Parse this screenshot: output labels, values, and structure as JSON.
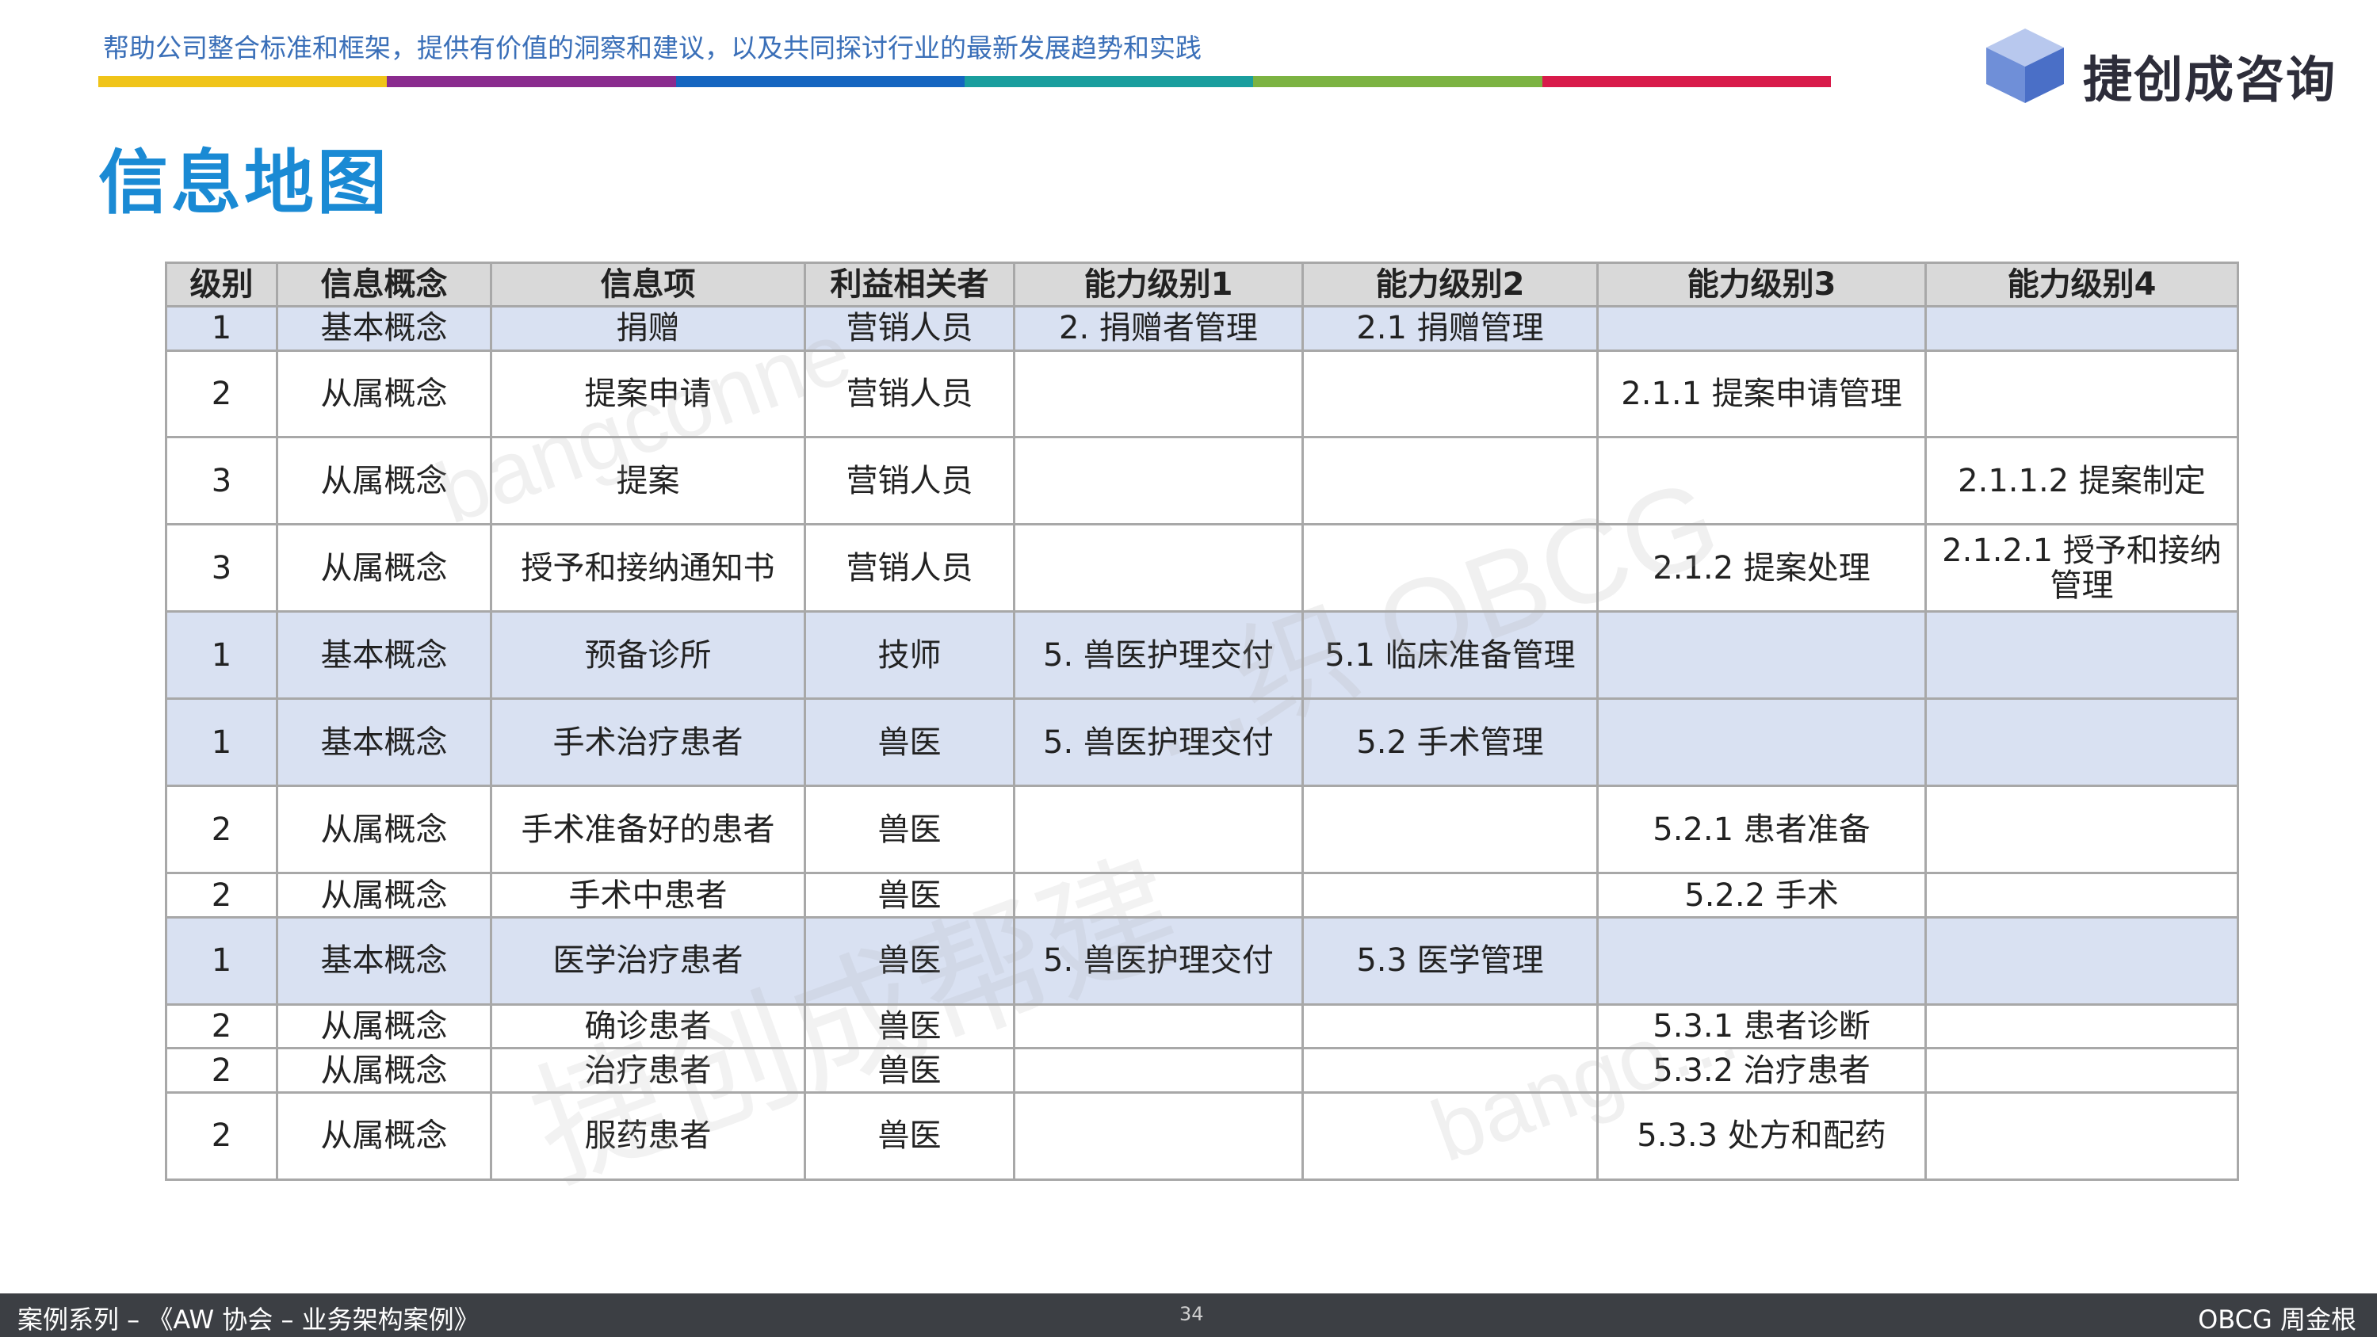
{
  "header": {
    "tagline": "帮助公司整合标准和框架，提供有价值的洞察和建议，以及共同探讨行业的最新发展趋势和实践",
    "bar_colors": [
      "#f0c419",
      "#8a2b8e",
      "#1565c0",
      "#1a9e9e",
      "#7cb342",
      "#d81b4a"
    ],
    "logo_text": "捷创成咨询",
    "logo_colors": [
      "#6f8fd8",
      "#4a6fc7",
      "#b8c8ee"
    ]
  },
  "title": "信息地图",
  "watermarks": [
    "bangconne",
    "...织 OBCG",
    "捷创成帮建",
    "bango..."
  ],
  "table": {
    "headers": [
      "级别",
      "信息概念",
      "信息项",
      "利益相关者",
      "能力级别1",
      "能力级别2",
      "能力级别3",
      "能力级别4"
    ],
    "rows": [
      {
        "level": "1",
        "concept": "基本概念",
        "item": "捐赠",
        "stakeholder": "营销人员",
        "cap1": "2. 捐赠者管理",
        "cap2": "2.1 捐赠管理",
        "cap3": "",
        "cap4": ""
      },
      {
        "level": "2",
        "concept": "从属概念",
        "item": "提案申请",
        "stakeholder": "营销人员",
        "cap1": "",
        "cap2": "",
        "cap3": "2.1.1 提案申请管理",
        "cap4": ""
      },
      {
        "level": "3",
        "concept": "从属概念",
        "item": "提案",
        "stakeholder": "营销人员",
        "cap1": "",
        "cap2": "",
        "cap3": "",
        "cap4": "2.1.1.2 提案制定"
      },
      {
        "level": "3",
        "concept": "从属概念",
        "item": "授予和接纳通知书",
        "stakeholder": "营销人员",
        "cap1": "",
        "cap2": "",
        "cap3": "2.1.2 提案处理",
        "cap4": "2.1.2.1 授予和接纳管理"
      },
      {
        "level": "1",
        "concept": "基本概念",
        "item": "预备诊所",
        "stakeholder": "技师",
        "cap1": "5. 兽医护理交付",
        "cap2": "5.1 临床准备管理",
        "cap3": "",
        "cap4": ""
      },
      {
        "level": "1",
        "concept": "基本概念",
        "item": "手术治疗患者",
        "stakeholder": "兽医",
        "cap1": "5. 兽医护理交付",
        "cap2": "5.2 手术管理",
        "cap3": "",
        "cap4": ""
      },
      {
        "level": "2",
        "concept": "从属概念",
        "item": "手术准备好的患者",
        "stakeholder": "兽医",
        "cap1": "",
        "cap2": "",
        "cap3": "5.2.1 患者准备",
        "cap4": ""
      },
      {
        "level": "2",
        "concept": "从属概念",
        "item": "手术中患者",
        "stakeholder": "兽医",
        "cap1": "",
        "cap2": "",
        "cap3": "5.2.2 手术",
        "cap4": ""
      },
      {
        "level": "1",
        "concept": "基本概念",
        "item": "医学治疗患者",
        "stakeholder": "兽医",
        "cap1": "5. 兽医护理交付",
        "cap2": "5.3 医学管理",
        "cap3": "",
        "cap4": ""
      },
      {
        "level": "2",
        "concept": "从属概念",
        "item": "确诊患者",
        "stakeholder": "兽医",
        "cap1": "",
        "cap2": "",
        "cap3": "5.3.1 患者诊断",
        "cap4": ""
      },
      {
        "level": "2",
        "concept": "从属概念",
        "item": "治疗患者",
        "stakeholder": "兽医",
        "cap1": "",
        "cap2": "",
        "cap3": "5.3.2 治疗患者",
        "cap4": ""
      },
      {
        "level": "2",
        "concept": "从属概念",
        "item": "服药患者",
        "stakeholder": "兽医",
        "cap1": "",
        "cap2": "",
        "cap3": "5.3.3 处方和配药",
        "cap4": ""
      }
    ]
  },
  "footer": {
    "left": "案例系列 – 《AW 协会 – 业务架构案例》",
    "page": "34",
    "right": "OBCG 周金根"
  }
}
